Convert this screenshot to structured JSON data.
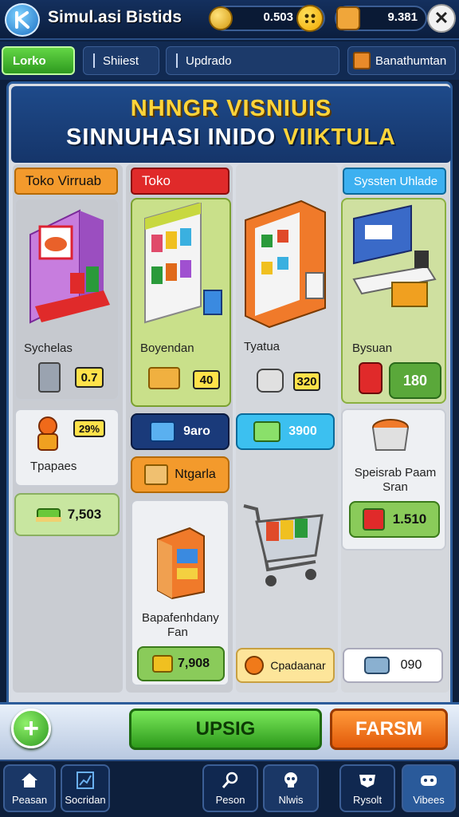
{
  "header": {
    "app_title": "Simul.asi Bistids",
    "coins": "0.503",
    "gems": "9.381",
    "icons": [
      "app-logo",
      "coin-icon",
      "smiley-icon",
      "character-icon",
      "close-icon"
    ]
  },
  "tabs": {
    "toko": "Lorko",
    "shiest": "Shiiest",
    "updrado": "Updrado",
    "generator": "Banathumtan"
  },
  "banner": {
    "line1": "NHNGR VISNIUIS",
    "line2_main": "SINNUHASI INIDO ",
    "line2_highlight": "VIIKTULA"
  },
  "col1": {
    "header": "Toko Virruab",
    "card1_label": "Sychelas",
    "card1_value": "0.7",
    "card2_badge": "29%",
    "card2_label": "Tpapaes",
    "card3_value": "7,503"
  },
  "col2": {
    "header": "Toko",
    "card1_label": "Boyendan",
    "card1_value": "40",
    "btn_blue": "9aro",
    "btn_orange": "Ntgarla",
    "card2_label_l1": "Bapafenhdany",
    "card2_label_l2": "Fan",
    "card2_value": "7,908"
  },
  "col3": {
    "card1_label": "Tyatua",
    "card1_value": "320",
    "btn_cyan": "3900",
    "btn_yellow": "Cpadaanar"
  },
  "col4": {
    "header": "Syssten Uhlade",
    "card1_label": "Bysuan",
    "card1_value": "180",
    "card2_label_l1": "Speisrab Paam",
    "card2_label_l2": "Sran",
    "card2_value": "1.510",
    "card3_value": "090"
  },
  "actions": {
    "primary": "UPSIG",
    "secondary": "FARSM"
  },
  "nav": [
    {
      "label": "Peasan",
      "icon": "home-icon"
    },
    {
      "label": "Socridan",
      "icon": "chart-icon"
    },
    {
      "label": "Peson",
      "icon": "tools-icon"
    },
    {
      "label": "Nlwis",
      "icon": "skull-icon"
    },
    {
      "label": "Rysolt",
      "icon": "mask-icon"
    },
    {
      "label": "Vibees",
      "icon": "gamepad-icon"
    }
  ],
  "colors": {
    "accent_green": "#3fae2a",
    "accent_orange": "#f07a1a",
    "accent_red": "#e0262a",
    "accent_cyan": "#3cc0f0",
    "navy": "#0d1f3c"
  }
}
